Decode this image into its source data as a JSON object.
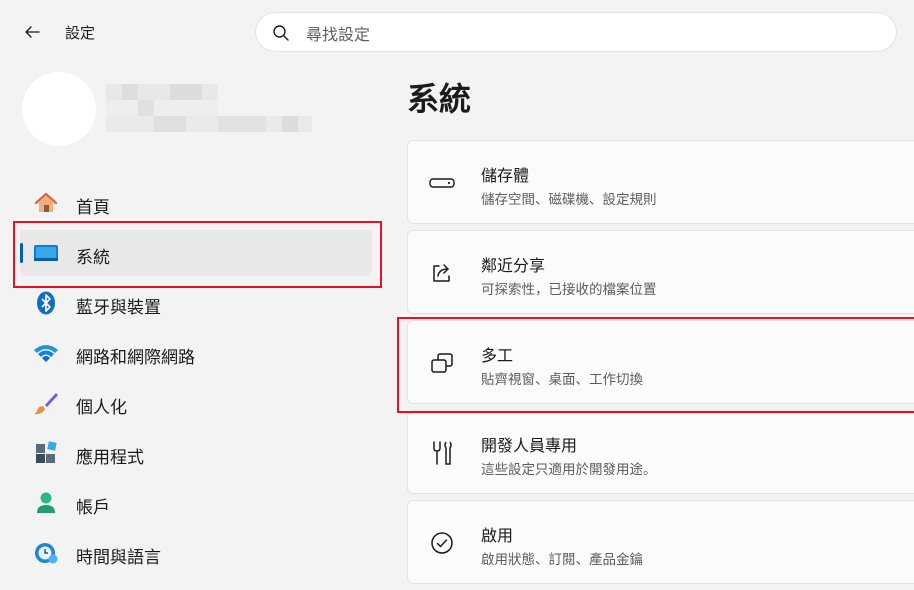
{
  "header": {
    "app_title": "設定",
    "search_placeholder": "尋找設定"
  },
  "sidebar": {
    "items": [
      {
        "label": "首頁",
        "icon": "home-icon"
      },
      {
        "label": "系統",
        "icon": "system-display-icon",
        "active": true
      },
      {
        "label": "藍牙與裝置",
        "icon": "bluetooth-icon"
      },
      {
        "label": "網路和網際網路",
        "icon": "wifi-icon"
      },
      {
        "label": "個人化",
        "icon": "brush-icon"
      },
      {
        "label": "應用程式",
        "icon": "apps-icon"
      },
      {
        "label": "帳戶",
        "icon": "account-icon"
      },
      {
        "label": "時間與語言",
        "icon": "time-language-icon"
      }
    ]
  },
  "main": {
    "title": "系統",
    "cards": [
      {
        "title": "儲存體",
        "desc": "儲存空間、磁碟機、設定規則",
        "icon": "storage-icon"
      },
      {
        "title": "鄰近分享",
        "desc": "可探索性，已接收的檔案位置",
        "icon": "share-icon"
      },
      {
        "title": "多工",
        "desc": "貼齊視窗、桌面、工作切換",
        "icon": "multitasking-icon"
      },
      {
        "title": "開發人員專用",
        "desc": "這些設定只適用於開發用途。",
        "icon": "developer-tools-icon"
      },
      {
        "title": "啟用",
        "desc": "啟用狀態、訂閱、產品金鑰",
        "icon": "activation-check-icon"
      }
    ]
  },
  "colors": {
    "accent": "#005fb8",
    "highlight": "#e81123"
  }
}
